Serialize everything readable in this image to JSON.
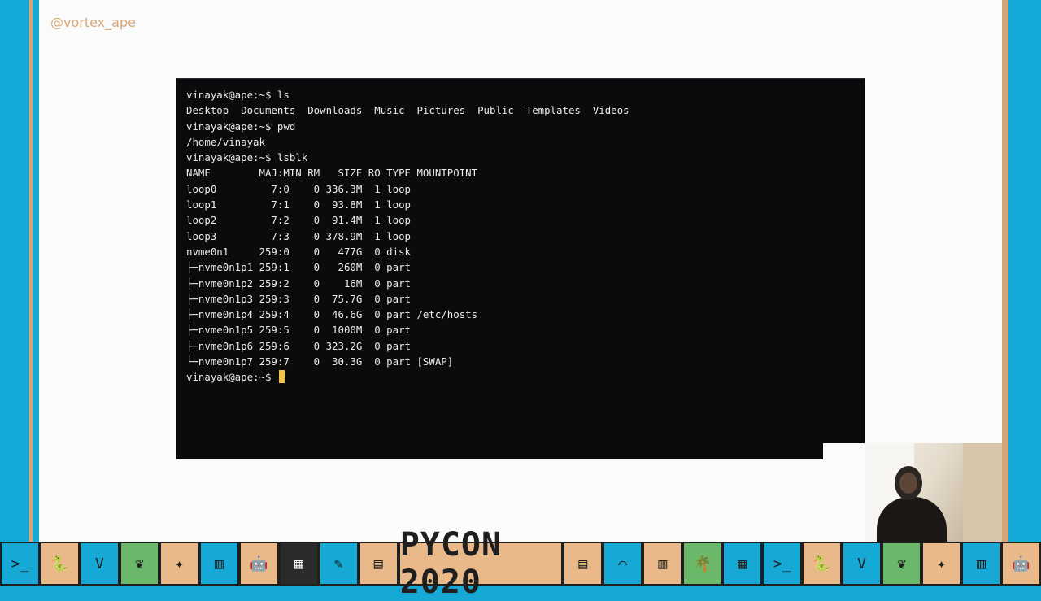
{
  "slide": {
    "handle": "@vortex_ape"
  },
  "terminal": {
    "lines": [
      "vinayak@ape:~$ ls",
      "Desktop  Documents  Downloads  Music  Pictures  Public  Templates  Videos",
      "vinayak@ape:~$ pwd",
      "/home/vinayak",
      "vinayak@ape:~$ lsblk",
      "NAME        MAJ:MIN RM   SIZE RO TYPE MOUNTPOINT",
      "loop0         7:0    0 336.3M  1 loop",
      "loop1         7:1    0  93.8M  1 loop",
      "loop2         7:2    0  91.4M  1 loop",
      "loop3         7:3    0 378.9M  1 loop",
      "nvme0n1     259:0    0   477G  0 disk",
      "├─nvme0n1p1 259:1    0   260M  0 part",
      "├─nvme0n1p2 259:2    0    16M  0 part",
      "├─nvme0n1p3 259:3    0  75.7G  0 part",
      "├─nvme0n1p4 259:4    0  46.6G  0 part /etc/hosts",
      "├─nvme0n1p5 259:5    0  1000M  0 part",
      "├─nvme0n1p6 259:6    0 323.2G  0 part",
      "└─nvme0n1p7 259:7    0  30.3G  0 part [SWAP]"
    ],
    "prompt": "vinayak@ape:~$ "
  },
  "footer": {
    "banner": "PYCON 2020",
    "left_tiles": [
      {
        "icon": ">_",
        "style": "tile"
      },
      {
        "icon": "🐍",
        "style": "tile alt"
      },
      {
        "icon": "V",
        "style": "tile"
      },
      {
        "icon": "❦",
        "style": "tile green"
      },
      {
        "icon": "✦",
        "style": "tile alt"
      },
      {
        "icon": "▥",
        "style": "tile"
      },
      {
        "icon": "🤖",
        "style": "tile alt"
      },
      {
        "icon": "▦",
        "style": "tile dark"
      },
      {
        "icon": "✎",
        "style": "tile"
      },
      {
        "icon": "▤",
        "style": "tile alt"
      }
    ],
    "right_tiles": [
      {
        "icon": "▤",
        "style": "tile alt"
      },
      {
        "icon": "⌒",
        "style": "tile"
      },
      {
        "icon": "▥",
        "style": "tile alt"
      },
      {
        "icon": "🌴",
        "style": "tile green"
      },
      {
        "icon": "▦",
        "style": "tile"
      },
      {
        "icon": ">_",
        "style": "tile"
      },
      {
        "icon": "🐍",
        "style": "tile alt"
      },
      {
        "icon": "V",
        "style": "tile"
      },
      {
        "icon": "❦",
        "style": "tile green"
      },
      {
        "icon": "✦",
        "style": "tile alt"
      },
      {
        "icon": "▥",
        "style": "tile"
      },
      {
        "icon": "🤖",
        "style": "tile alt"
      }
    ]
  }
}
